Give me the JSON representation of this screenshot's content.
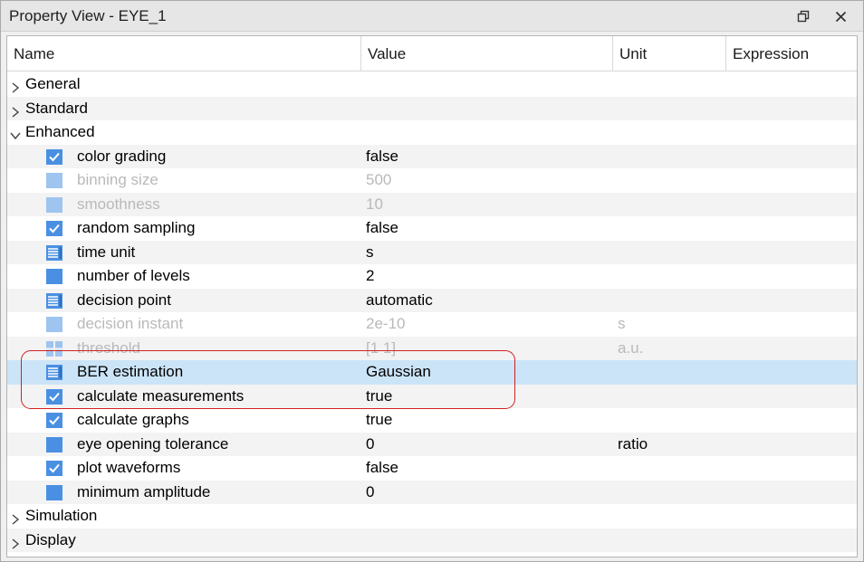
{
  "window": {
    "title": "Property View - EYE_1"
  },
  "columns": {
    "name": "Name",
    "value": "Value",
    "unit": "Unit",
    "expression": "Expression"
  },
  "groups_before": [
    {
      "label": "General",
      "expanded": false
    },
    {
      "label": "Standard",
      "expanded": false
    },
    {
      "label": "Enhanced",
      "expanded": true
    }
  ],
  "properties": [
    {
      "name": "color grading",
      "value": "false",
      "unit": "",
      "icon": "checkbox-icon",
      "disabled": false
    },
    {
      "name": "binning size",
      "value": "500",
      "unit": "",
      "icon": "square-icon",
      "disabled": true
    },
    {
      "name": "smoothness",
      "value": "10",
      "unit": "",
      "icon": "square-icon",
      "disabled": true
    },
    {
      "name": "random sampling",
      "value": "false",
      "unit": "",
      "icon": "checkbox-icon",
      "disabled": false
    },
    {
      "name": "time unit",
      "value": "s",
      "unit": "",
      "icon": "list-icon",
      "disabled": false
    },
    {
      "name": "number of levels",
      "value": "2",
      "unit": "",
      "icon": "square-icon",
      "disabled": false
    },
    {
      "name": "decision point",
      "value": "automatic",
      "unit": "",
      "icon": "list-icon",
      "disabled": false
    },
    {
      "name": "decision instant",
      "value": "2e-10",
      "unit": "s",
      "icon": "square-icon",
      "disabled": true
    },
    {
      "name": "threshold",
      "value": "[1 1]",
      "unit": "a.u.",
      "icon": "grid-icon",
      "disabled": true
    },
    {
      "name": "BER estimation",
      "value": "Gaussian",
      "unit": "",
      "icon": "list-icon",
      "disabled": false,
      "selected": true
    },
    {
      "name": "calculate measurements",
      "value": "true",
      "unit": "",
      "icon": "checkbox-icon",
      "disabled": false
    },
    {
      "name": "calculate graphs",
      "value": "true",
      "unit": "",
      "icon": "checkbox-icon",
      "disabled": false
    },
    {
      "name": "eye opening tolerance",
      "value": "0",
      "unit": "ratio",
      "icon": "square-icon",
      "disabled": false
    },
    {
      "name": "plot waveforms",
      "value": "false",
      "unit": "",
      "icon": "checkbox-icon",
      "disabled": false
    },
    {
      "name": "minimum amplitude",
      "value": "0",
      "unit": "",
      "icon": "square-icon",
      "disabled": false
    }
  ],
  "groups_after": [
    {
      "label": "Simulation",
      "expanded": false
    },
    {
      "label": "Display",
      "expanded": false
    }
  ],
  "colors": {
    "icon_blue": "#4a90e2",
    "icon_blue_light": "#9ec4ef",
    "selected_row": "#cce4f7",
    "highlight_outline": "#d42020"
  }
}
